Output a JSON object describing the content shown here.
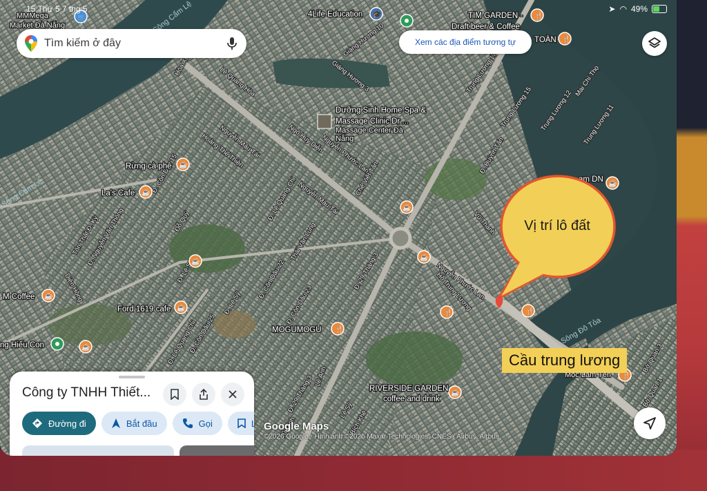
{
  "status_bar": {
    "time": "15   Thứ 5 7 thg 5",
    "battery": "49%"
  },
  "search": {
    "placeholder": "Tìm kiếm ở đây"
  },
  "similar_button": "Xem các địa điểm tương tự",
  "map_labels": {
    "mega_market": "MMMega",
    "mega_market_2": "Market Đà Nẵng",
    "life_edu": "4Life Education",
    "tim_garden": "TIM GARDEN -",
    "tim_garden_2": "Draft beer & Coffee",
    "toan": "TOÀN",
    "spa_1": "Dưỡng Sinh Home Spa &",
    "spa_2": "Massage Clinic Dr ...",
    "spa_3": "Massage Center Đà",
    "spa_4": "Nẵng",
    "rung_ca_phe": "Rừng cà phê",
    "la_cafe": "La's Cafe",
    "m_coffee": "M Coffee",
    "ford_cafe": "Ford 1619 cafe",
    "hieu_con": "ng Hiếu Con",
    "mogumogu": "MOGUMOGU",
    "riverside_1": "RIVERSIDE GARDEN",
    "riverside_2": "coffee and drink",
    "lam_dn": "am DN",
    "moc_lam": "Mộc Lam Tên",
    "song_cam_le": "Sông Cẩm Lệ",
    "song_cam_le_2": "Sông Cẩm Lệ",
    "song_do_toa": "Sông Đô Tỏa"
  },
  "streets": [
    "Nguyễn Phước Lan",
    "Nguyễn Phước Lan",
    "Ngô Huy Diễn",
    "Lê Quang Hòa",
    "Giáng Hương 10",
    "Giáng Hương 3",
    "Trung Lương 17",
    "Trung Lương 15",
    "Trung Lương 12",
    "Mai Chí Thọ",
    "Trung Lương 11",
    "Đ. 29 Tháng 3",
    "Đ. 29 Tháng 3",
    "Đ. Lê Quang Chi",
    "Đ. Lê Quang Chi",
    "Đ. Cồn Dầu 15",
    "Đ. Cồn Dầu 22",
    "Đ. Cồn Dầu 23",
    "Đ. Cồn Dầu 25",
    "Tôn Thất Đ. Kỳ",
    "Đ. Nguyễn Văn Thông",
    "Diên Hồng",
    "Nguyễn Mậu Tài",
    "Hoàng Thế Thiện",
    "Hồ Trung Lượng",
    "Vũ Thạnh",
    "Chế Viết Tấn",
    "Đ. Lê Sỹ",
    "Đ. Lê Sỹ",
    "Bờ Quan 3",
    "Bờ Quan 1",
    "Hòa Xuân",
    "Lê Sỹ",
    "Bích Khê",
    "Vũ Đình",
    "Lê Anh",
    "Nguyễn Mậu Tài",
    "Đỗ Quý",
    "Đ. Huỳnh Tấn",
    "Thái Văn Lung"
  ],
  "callout": {
    "text": "Vị trí lô đất",
    "bg": "#f2cf56",
    "border": "#e2562f"
  },
  "bridge_label": "Cầu trung lương",
  "attribution": {
    "brand": "Google Maps",
    "credit": "©2026 Google · Hình ảnh ©2026 Maxar Technologies, CNES / Airbus, Airbus"
  },
  "place_sheet": {
    "title": "Công ty TNHH Thiết...",
    "actions": [
      "Đường đi",
      "Bắt đầu",
      "Gọi",
      "L"
    ]
  },
  "colors": {
    "accent": "#1f6b7e",
    "link": "#1a56b8",
    "pin": "#e64a3b"
  },
  "icons": [
    "maps-pin-icon",
    "mic-icon",
    "layers-icon",
    "locate-arrow-icon",
    "bookmark-icon",
    "share-icon",
    "close-icon",
    "directions-icon",
    "navigate-icon",
    "phone-icon",
    "cafe-icon",
    "restaurant-icon",
    "school-icon"
  ]
}
